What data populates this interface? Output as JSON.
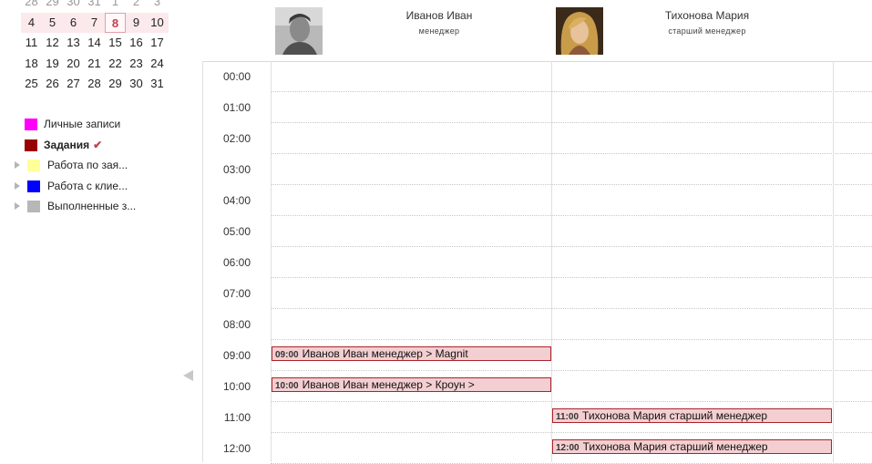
{
  "mini_calendar": {
    "rows": [
      {
        "days": [
          "28",
          "29",
          "30",
          "31",
          "1",
          "2",
          "3"
        ],
        "state": "partial"
      },
      {
        "days": [
          "4",
          "5",
          "6",
          "7",
          "8",
          "9",
          "10"
        ],
        "state": "current"
      },
      {
        "days": [
          "11",
          "12",
          "13",
          "14",
          "15",
          "16",
          "17"
        ],
        "state": "normal"
      },
      {
        "days": [
          "18",
          "19",
          "20",
          "21",
          "22",
          "23",
          "24"
        ],
        "state": "normal"
      },
      {
        "days": [
          "25",
          "26",
          "27",
          "28",
          "29",
          "30",
          "31"
        ],
        "state": "normal"
      }
    ],
    "today": "8"
  },
  "legend": {
    "items": [
      {
        "label": "Личные записи",
        "color": "#ff00ff",
        "level": "top",
        "active": false
      },
      {
        "label": "Задания",
        "color": "#990000",
        "level": "top",
        "active": true
      },
      {
        "label": "Работа по зая...",
        "color": "#ffff99",
        "level": "sub",
        "active": false
      },
      {
        "label": "Работа с клие...",
        "color": "#0000ff",
        "level": "sub",
        "active": false
      },
      {
        "label": "Выполненные з...",
        "color": "#b7b7b7",
        "level": "sub",
        "active": false
      }
    ],
    "check_icon": "✔"
  },
  "people": [
    {
      "name": "Иванов Иван",
      "role": "менеджер",
      "avatar": "man-photo"
    },
    {
      "name": "Тихонова Мария",
      "role": "старший менеджер",
      "avatar": "woman-photo"
    }
  ],
  "times": [
    "00:00",
    "01:00",
    "02:00",
    "03:00",
    "04:00",
    "05:00",
    "06:00",
    "07:00",
    "08:00",
    "09:00",
    "10:00",
    "11:00",
    "12:00"
  ],
  "events": [
    {
      "time": "09:00",
      "text": "Иванов Иван менеджер  > Magnit",
      "column": 0,
      "hour": 9
    },
    {
      "time": "10:00",
      "text": "Иванов Иван менеджер  > Кроун >",
      "column": 0,
      "hour": 10
    },
    {
      "time": "11:00",
      "text": "Тихонова Мария старший менеджер",
      "column": 1,
      "hour": 11
    },
    {
      "time": "12:00",
      "text": "Тихонова Мария старший менеджер",
      "column": 1,
      "hour": 12
    }
  ],
  "colors": {
    "event_bg": "#f4cfd1",
    "event_border": "#a8242c",
    "today": "#c0414d"
  }
}
